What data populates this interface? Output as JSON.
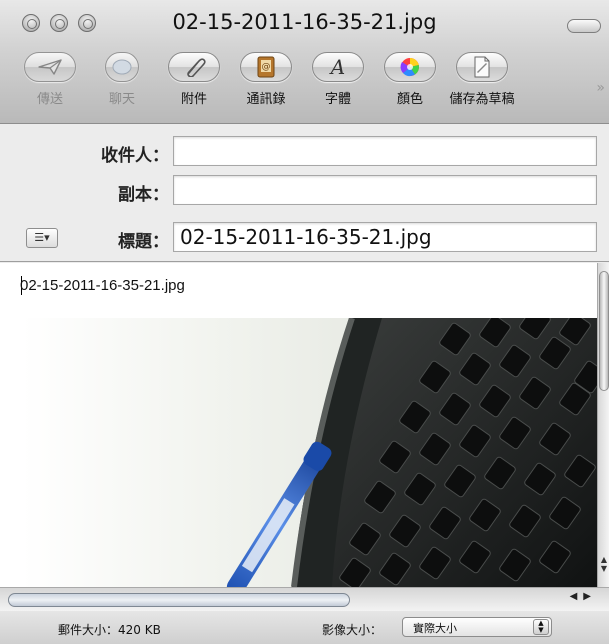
{
  "window": {
    "title": "02-15-2011-16-35-21.jpg"
  },
  "toolbar": {
    "items": [
      {
        "label": "傳送",
        "icon": "send-icon",
        "enabled": false
      },
      {
        "label": "聊天",
        "icon": "chat-icon",
        "enabled": false
      },
      {
        "label": "附件",
        "icon": "paperclip-icon",
        "enabled": true
      },
      {
        "label": "通訊錄",
        "icon": "address-book-icon",
        "enabled": true
      },
      {
        "label": "字體",
        "icon": "font-icon",
        "enabled": true
      },
      {
        "label": "顏色",
        "icon": "color-wheel-icon",
        "enabled": true
      },
      {
        "label": "儲存為草稿",
        "icon": "save-draft-icon",
        "enabled": true
      }
    ]
  },
  "headers": {
    "to_label": "收件人：",
    "to_value": "",
    "cc_label": "副本：",
    "cc_value": "",
    "subject_label": "標題：",
    "subject_value": "02-15-2011-16-35-21.jpg"
  },
  "body": {
    "text": "02-15-2011-16-35-21.jpg",
    "attachment_description": "Photo of a black computer keyboard with a blue pen"
  },
  "status": {
    "message_size_label": "郵件大小：",
    "message_size_value": "420 KB",
    "image_size_label": "影像大小：",
    "image_size_selected": "實際大小"
  },
  "colors": {
    "chrome_top": "#e8e8e8",
    "chrome_bottom": "#b9b9b9",
    "window_bg": "#ececec",
    "pen_blue": "#2f66c9"
  }
}
